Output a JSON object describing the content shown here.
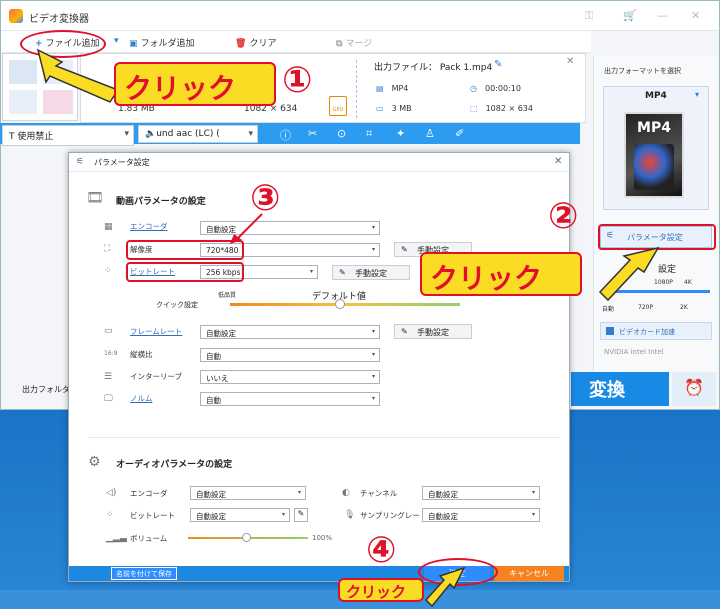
{
  "app": {
    "title": "ビデオ変換器"
  },
  "toolbar": {
    "add_file": "ファイル追加",
    "add_folder": "フォルダ追加",
    "clear": "クリア",
    "merge": "マージ"
  },
  "file": {
    "output_file": "出力ファイル： Pack 1.mp4",
    "format": "MP4",
    "duration": "00:00:10",
    "size": "3 MB",
    "resolution": "1082 × 634",
    "blur_left": "1.83 MB",
    "blur_right": "1082 × 634",
    "gpu": "GPU"
  },
  "bluebar": {
    "subtitle": "使用禁止",
    "audio": "und aac (LC) (",
    "subtitle_icon": "T",
    "audio_icon": "speaker-icon"
  },
  "right_panel": {
    "output_format_label": "出力フォーマットを選択",
    "format": "MP4",
    "format_icon_text": "MP4",
    "param_button": "パラメータ設定",
    "quality_label": "設定",
    "ticks_top": [
      "1080P",
      "4K"
    ],
    "ticks_bottom": [
      "自動",
      "720P",
      "2K"
    ],
    "hw_accel": "ビデオカード加速",
    "vendors": "NVIDIA  intel  Intel",
    "convert": "変換"
  },
  "output_folder_label": "出力フォルダ",
  "dialog": {
    "title": "パラメータ設定",
    "video_section": "動画パラメータの設定",
    "video": {
      "encoder_label": "エンコーダ",
      "encoder_value": "自動設定",
      "resolution_label": "解像度",
      "resolution_value": "720*480",
      "bitrate_label": "ビットレート",
      "bitrate_value": "256 kbps",
      "framerate_label": "フレームレート",
      "framerate_value": "自動設定",
      "aspect_label": "縦横比",
      "aspect_value": "自動",
      "interlace_label": "インターリーブ",
      "interlace_value": "いいえ",
      "norm_label": "ノルム",
      "norm_value": "自動",
      "manual": "手動設定",
      "quick_label": "クイック設定",
      "quick_low": "低品質",
      "quick_default": "デフォルト値"
    },
    "audio_section": "オーディオパラメータの設定",
    "audio": {
      "encoder_label": "エンコーダ",
      "encoder_value": "自動設定",
      "channel_label": "チャンネル",
      "channel_value": "自動設定",
      "bitrate_label": "ビットレート",
      "bitrate_value": "自動設定",
      "samplerate_label": "サンプリングレート",
      "samplerate_value": "自動設定",
      "volume_label": "ボリューム",
      "volume_value": "100%"
    },
    "save_as": "名前を付けて保存",
    "ok": "確定",
    "cancel": "キャンセル"
  },
  "annotations": {
    "click": "クリック",
    "num1": "①",
    "num2": "②",
    "num3": "③",
    "num4": "④"
  },
  "colors": {
    "accent": "#2d9cf0",
    "annotation_red": "#e0102a",
    "annotation_yellow": "#fbdc25",
    "cancel_orange": "#f58220"
  }
}
